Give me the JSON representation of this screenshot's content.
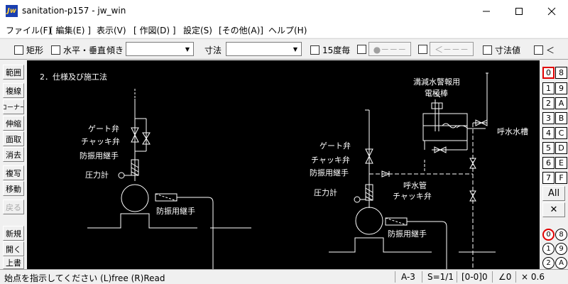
{
  "window": {
    "title": "sanitation-p157 - jw_win",
    "app_icon_text": "Jw",
    "controls": [
      "minimize-icon",
      "maximize-icon",
      "close-icon"
    ]
  },
  "menu": [
    "ファイル(F)",
    "[ 編集(E) ]",
    "表示(V)",
    "[ 作図(D) ]",
    "設定(S)",
    "[その他(A)]",
    "ヘルプ(H)"
  ],
  "toolbar": {
    "rect_label": "矩形",
    "hv_label": "水平・垂直",
    "tilt_label": "傾き",
    "tilt_value": "",
    "dim_label": "寸法",
    "dim_value": "",
    "deg15_label": "15度毎",
    "btn_dot": "●－－－",
    "btn_arrow": "＜－－－",
    "dimval_label": "寸法値",
    "last_label": "＜"
  },
  "left_tools": [
    "範囲",
    "複線",
    "コーナー",
    "伸縮",
    "面取",
    "消去",
    "複写",
    "移動",
    "戻る",
    "新規",
    "開く",
    "上書"
  ],
  "left_tools_disabled": [
    "戻る"
  ],
  "right_tools": {
    "layers_left": [
      "0",
      "1",
      "2",
      "3",
      "4",
      "5",
      "6",
      "7"
    ],
    "layers_right": [
      "8",
      "9",
      "A",
      "B",
      "C",
      "D",
      "E",
      "F"
    ],
    "active_layer": "0",
    "all_label": "All",
    "close_label": "✕",
    "groups_left": [
      "0",
      "1",
      "2"
    ],
    "groups_right": [
      "8",
      "9",
      "A"
    ]
  },
  "drawing": {
    "heading": "2．仕様及び施工法",
    "left_labels": {
      "gate_valve": "ゲート弁",
      "check_valve": "チャッキ弁",
      "anti_vib1": "防振用継手",
      "pressure_gauge": "圧力計",
      "anti_vib2": "防振用継手"
    },
    "right_labels": {
      "alarm1": "満減水警報用",
      "alarm2": "電極棒",
      "priming_tank": "呼水水槽",
      "gate_valve": "ゲート弁",
      "check_valve": "チャッキ弁",
      "anti_vib1": "防振用継手",
      "priming_pipe": "呼水管",
      "check_valve2": "チャッキ弁",
      "pressure_gauge": "圧力計",
      "anti_vib2": "防振用継手"
    }
  },
  "status": {
    "message": "始点を指示してください (L)free (R)Read",
    "paper": "A-3",
    "scale": "S=1/1",
    "layer_info": "[0-0]0",
    "angle": "∠0",
    "zoom": "× 0.6"
  },
  "colors": {
    "canvas_bg": "#000000",
    "line_white": "#ffffff",
    "text_white": "#ffffff",
    "active_layer_border": "#e00000",
    "app_icon_bg": "#1a3fb0"
  }
}
